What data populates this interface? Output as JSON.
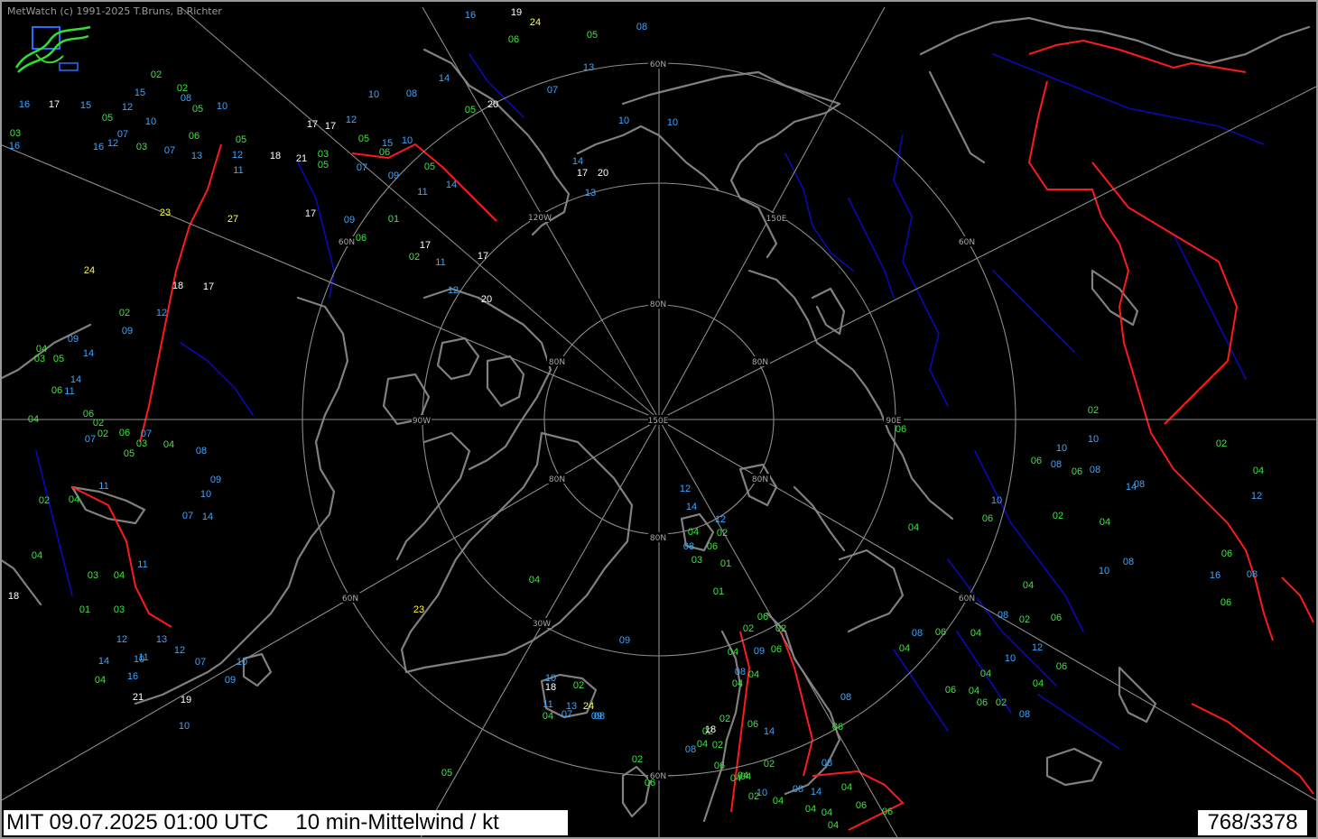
{
  "header": {
    "credit": "MetWatch  (c) 1991-2025 T.Bruns, B.Richter"
  },
  "footer": {
    "valid_time": "MIT 09.07.2025 01:00 UTC",
    "product": "10 min-Mittelwind / kt",
    "station_count": "768/3378"
  },
  "colors": {
    "background": "#000000",
    "coastline": "#808080",
    "graticule": "#8c8c8c",
    "rivers": "#0a0ab4",
    "borders": "#ff1a1a",
    "wind_02_06": "#3ce63c",
    "wind_07_16": "#3aa6ff",
    "wind_17_22": "#ffffff",
    "wind_23_plus": "#ffff3c"
  },
  "icons": {
    "logo": "metwatch-logo-icon"
  },
  "graticule_labels": [
    {
      "id": "60n-top",
      "text": "60N"
    },
    {
      "id": "150e-upper",
      "text": "150E"
    },
    {
      "id": "60n-upper-left",
      "text": "60N"
    },
    {
      "id": "120w",
      "text": "120W"
    },
    {
      "id": "60n-upper-right",
      "text": "60N"
    },
    {
      "id": "80n-top",
      "text": "80N"
    },
    {
      "id": "80n-left",
      "text": "80N"
    },
    {
      "id": "80n-right",
      "text": "80N"
    },
    {
      "id": "90w",
      "text": "90W"
    },
    {
      "id": "150e-center",
      "text": "150E"
    },
    {
      "id": "90e",
      "text": "90E"
    },
    {
      "id": "80n-lower-left",
      "text": "80N"
    },
    {
      "id": "80n-lower-right",
      "text": "80N"
    },
    {
      "id": "80n-bottom",
      "text": "80N"
    },
    {
      "id": "60n-lower-left",
      "text": "60N"
    },
    {
      "id": "60n-lower-right",
      "text": "60N"
    },
    {
      "id": "30w",
      "text": "30W"
    },
    {
      "id": "60n-bottom",
      "text": "60N"
    }
  ],
  "wind_observations": [
    {
      "kt": "16"
    },
    {
      "kt": "19"
    },
    {
      "kt": "24"
    },
    {
      "kt": "06"
    },
    {
      "kt": "05"
    },
    {
      "kt": "08"
    },
    {
      "kt": "13"
    },
    {
      "kt": "07"
    },
    {
      "kt": "02"
    },
    {
      "kt": "10"
    },
    {
      "kt": "08"
    },
    {
      "kt": "16"
    },
    {
      "kt": "17"
    },
    {
      "kt": "15"
    },
    {
      "kt": "08"
    },
    {
      "kt": "02"
    },
    {
      "kt": "15"
    },
    {
      "kt": "05"
    },
    {
      "kt": "12"
    },
    {
      "kt": "05"
    },
    {
      "kt": "10"
    },
    {
      "kt": "10"
    },
    {
      "kt": "03"
    },
    {
      "kt": "20"
    },
    {
      "kt": "05"
    },
    {
      "kt": "14"
    },
    {
      "kt": "10"
    },
    {
      "kt": "10"
    },
    {
      "kt": "16"
    },
    {
      "kt": "12"
    },
    {
      "kt": "03"
    },
    {
      "kt": "07"
    },
    {
      "kt": "13"
    },
    {
      "kt": "11"
    },
    {
      "kt": "12"
    },
    {
      "kt": "18"
    },
    {
      "kt": "21"
    },
    {
      "kt": "03"
    },
    {
      "kt": "12"
    },
    {
      "kt": "17"
    },
    {
      "kt": "05"
    },
    {
      "kt": "05"
    },
    {
      "kt": "16"
    },
    {
      "kt": "07"
    },
    {
      "kt": "06"
    },
    {
      "kt": "17"
    },
    {
      "kt": "05"
    },
    {
      "kt": "15"
    },
    {
      "kt": "10"
    },
    {
      "kt": "09"
    },
    {
      "kt": "06"
    },
    {
      "kt": "07"
    },
    {
      "kt": "11"
    },
    {
      "kt": "05"
    },
    {
      "kt": "14"
    },
    {
      "kt": "17"
    },
    {
      "kt": "20"
    },
    {
      "kt": "14"
    },
    {
      "kt": "13"
    },
    {
      "kt": "23"
    },
    {
      "kt": "27"
    },
    {
      "kt": "17"
    },
    {
      "kt": "09"
    },
    {
      "kt": "06"
    },
    {
      "kt": "01"
    },
    {
      "kt": "17"
    },
    {
      "kt": "02"
    },
    {
      "kt": "11"
    },
    {
      "kt": "12"
    },
    {
      "kt": "17"
    },
    {
      "kt": "20"
    },
    {
      "kt": "24"
    },
    {
      "kt": "18"
    },
    {
      "kt": "17"
    },
    {
      "kt": "12"
    },
    {
      "kt": "02"
    },
    {
      "kt": "09"
    },
    {
      "kt": "09"
    },
    {
      "kt": "14"
    },
    {
      "kt": "04"
    },
    {
      "kt": "03"
    },
    {
      "kt": "05"
    },
    {
      "kt": "06"
    },
    {
      "kt": "14"
    },
    {
      "kt": "11"
    },
    {
      "kt": "06"
    },
    {
      "kt": "04"
    },
    {
      "kt": "02"
    },
    {
      "kt": "02"
    },
    {
      "kt": "07"
    },
    {
      "kt": "03"
    },
    {
      "kt": "06"
    },
    {
      "kt": "07"
    },
    {
      "kt": "04"
    },
    {
      "kt": "05"
    },
    {
      "kt": "08"
    },
    {
      "kt": "09"
    },
    {
      "kt": "10"
    },
    {
      "kt": "14"
    },
    {
      "kt": "11"
    },
    {
      "kt": "02"
    },
    {
      "kt": "04"
    },
    {
      "kt": "07"
    },
    {
      "kt": "03"
    },
    {
      "kt": "04"
    },
    {
      "kt": "01"
    },
    {
      "kt": "03"
    },
    {
      "kt": "12"
    },
    {
      "kt": "04"
    },
    {
      "kt": "18"
    },
    {
      "kt": "23"
    },
    {
      "kt": "21"
    },
    {
      "kt": "19"
    },
    {
      "kt": "14"
    },
    {
      "kt": "16"
    },
    {
      "kt": "04"
    },
    {
      "kt": "11"
    },
    {
      "kt": "10"
    },
    {
      "kt": "07"
    },
    {
      "kt": "12"
    },
    {
      "kt": "10"
    },
    {
      "kt": "13"
    },
    {
      "kt": "11"
    },
    {
      "kt": "09"
    },
    {
      "kt": "10"
    },
    {
      "kt": "05"
    },
    {
      "kt": "06"
    },
    {
      "kt": "02"
    },
    {
      "kt": "24"
    },
    {
      "kt": "11"
    },
    {
      "kt": "13"
    },
    {
      "kt": "09"
    },
    {
      "kt": "04"
    },
    {
      "kt": "07"
    },
    {
      "kt": "08"
    },
    {
      "kt": "10"
    },
    {
      "kt": "18"
    },
    {
      "kt": "02"
    },
    {
      "kt": "02"
    },
    {
      "kt": "08"
    },
    {
      "kt": "09"
    },
    {
      "kt": "04"
    },
    {
      "kt": "12"
    },
    {
      "kt": "14"
    },
    {
      "kt": "12"
    },
    {
      "kt": "02"
    },
    {
      "kt": "06"
    },
    {
      "kt": "04"
    },
    {
      "kt": "08"
    },
    {
      "kt": "03"
    },
    {
      "kt": "01"
    },
    {
      "kt": "01"
    },
    {
      "kt": "06"
    },
    {
      "kt": "02"
    },
    {
      "kt": "02"
    },
    {
      "kt": "04"
    },
    {
      "kt": "06"
    },
    {
      "kt": "09"
    },
    {
      "kt": "08"
    },
    {
      "kt": "04"
    },
    {
      "kt": "04"
    },
    {
      "kt": "06"
    },
    {
      "kt": "14"
    },
    {
      "kt": "02"
    },
    {
      "kt": "18"
    },
    {
      "kt": "04"
    },
    {
      "kt": "02"
    },
    {
      "kt": "02"
    },
    {
      "kt": "04"
    },
    {
      "kt": "06"
    },
    {
      "kt": "04"
    },
    {
      "kt": "04"
    },
    {
      "kt": "02"
    },
    {
      "kt": "10"
    },
    {
      "kt": "04"
    },
    {
      "kt": "08"
    },
    {
      "kt": "04"
    },
    {
      "kt": "14"
    },
    {
      "kt": "04"
    },
    {
      "kt": "08"
    },
    {
      "kt": "04"
    },
    {
      "kt": "06"
    },
    {
      "kt": "08"
    },
    {
      "kt": "06"
    },
    {
      "kt": "06"
    },
    {
      "kt": "04"
    },
    {
      "kt": "06"
    },
    {
      "kt": "10"
    },
    {
      "kt": "10"
    },
    {
      "kt": "08"
    },
    {
      "kt": "06"
    },
    {
      "kt": "06"
    },
    {
      "kt": "08"
    },
    {
      "kt": "10"
    },
    {
      "kt": "06"
    },
    {
      "kt": "02"
    },
    {
      "kt": "04"
    },
    {
      "kt": "02"
    },
    {
      "kt": "04"
    },
    {
      "kt": "14"
    },
    {
      "kt": "08"
    },
    {
      "kt": "02"
    },
    {
      "kt": "04"
    },
    {
      "kt": "12"
    },
    {
      "kt": "06"
    },
    {
      "kt": "16"
    },
    {
      "kt": "08"
    },
    {
      "kt": "06"
    },
    {
      "kt": "08"
    },
    {
      "kt": "10"
    },
    {
      "kt": "04"
    },
    {
      "kt": "08"
    },
    {
      "kt": "02"
    },
    {
      "kt": "06"
    },
    {
      "kt": "04"
    },
    {
      "kt": "06"
    },
    {
      "kt": "08"
    },
    {
      "kt": "10"
    },
    {
      "kt": "12"
    },
    {
      "kt": "06"
    },
    {
      "kt": "04"
    },
    {
      "kt": "04"
    },
    {
      "kt": "06"
    },
    {
      "kt": "04"
    },
    {
      "kt": "02"
    },
    {
      "kt": "08"
    },
    {
      "kt": "06"
    },
    {
      "kt": "04"
    },
    {
      "kt": "10"
    },
    {
      "kt": "02"
    },
    {
      "kt": "04"
    },
    {
      "kt": "06"
    },
    {
      "kt": "06"
    },
    {
      "kt": "10"
    },
    {
      "kt": "08"
    },
    {
      "kt": "06"
    },
    {
      "kt": "08"
    }
  ]
}
